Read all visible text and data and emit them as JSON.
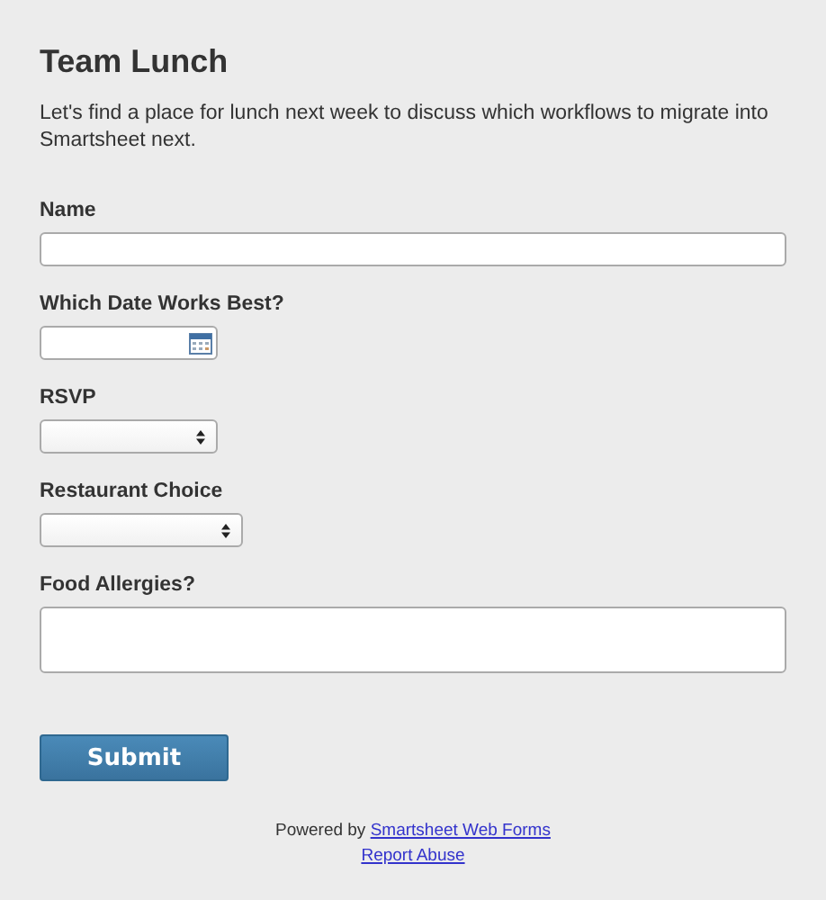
{
  "form": {
    "title": "Team Lunch",
    "description": "Let's find a place for lunch next week to discuss which workflows to migrate into Smartsheet next.",
    "fields": [
      {
        "label": "Name",
        "kind": "text"
      },
      {
        "label": "Which Date Works Best?",
        "kind": "date"
      },
      {
        "label": "RSVP",
        "kind": "select"
      },
      {
        "label": "Restaurant Choice",
        "kind": "select-wide"
      },
      {
        "label": "Food Allergies?",
        "kind": "textarea"
      }
    ],
    "submit": "Submit"
  },
  "footer": {
    "powered_by": "Powered by",
    "powered_link": "Smartsheet Web Forms",
    "report_link": "Report Abuse"
  }
}
